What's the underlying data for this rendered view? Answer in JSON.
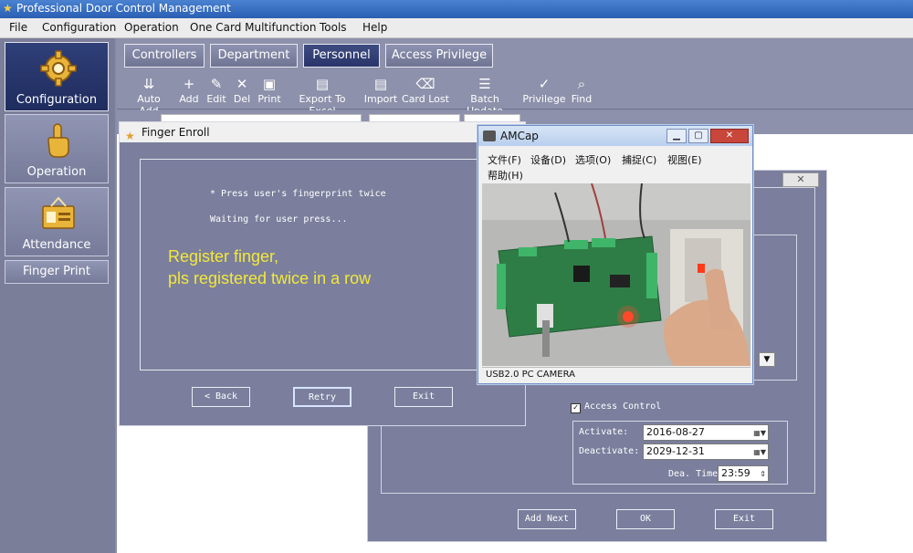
{
  "app": {
    "title": "Professional Door Control Management"
  },
  "menu": [
    "File",
    "Configuration",
    "Operation",
    "One Card Multifunction",
    "Tools",
    "Help"
  ],
  "sidebar": {
    "items": [
      {
        "label": "Configuration",
        "icon": "gear-icon",
        "active": true
      },
      {
        "label": "Operation",
        "icon": "hand-pointer-icon",
        "active": false
      },
      {
        "label": "Attendance",
        "icon": "attendance-card-icon",
        "active": false
      },
      {
        "label": "Finger Print",
        "icon": "",
        "active": false
      }
    ]
  },
  "tabs": [
    "Controllers",
    "Department",
    "Personnel",
    "Access Privilege"
  ],
  "toolbar": [
    {
      "label": "Auto Add",
      "icon": "auto-add-icon"
    },
    {
      "label": "Add",
      "icon": "plus-icon"
    },
    {
      "label": "Edit",
      "icon": "pencil-icon"
    },
    {
      "label": "Del",
      "icon": "x-icon"
    },
    {
      "label": "Print",
      "icon": "printer-icon"
    },
    {
      "label": "Export To Excel",
      "icon": "excel-icon"
    },
    {
      "label": "Import",
      "icon": "import-icon"
    },
    {
      "label": "Card Lost",
      "icon": "card-lost-icon"
    },
    {
      "label": "Batch Update",
      "icon": "batch-update-icon"
    },
    {
      "label": "Privilege",
      "icon": "privilege-icon"
    },
    {
      "label": "Find",
      "icon": "search-icon"
    }
  ],
  "finger_enroll": {
    "title": "Finger Enroll",
    "line1": "* Press user's fingerprint twice",
    "line2": "Waiting for user press...",
    "note_line1": "Register finger,",
    "note_line2": "pls registered twice in a row",
    "buttons": {
      "back": "< Back",
      "retry": "Retry",
      "exit": "Exit"
    }
  },
  "amcap": {
    "title": "AMCap",
    "menu_row1": [
      "文件(F)",
      "设备(D)",
      "选项(O)",
      "捕捉(C)",
      "视图(E)"
    ],
    "menu_row2": [
      "帮助(H)"
    ],
    "status": "USB2.0 PC CAMERA"
  },
  "privilege_dialog": {
    "access_control": {
      "label": "Access Control",
      "checked": true
    },
    "activate": {
      "label": "Activate:",
      "value": "2016-08-27"
    },
    "deactivate": {
      "label": "Deactivate:",
      "value": "2029-12-31"
    },
    "dea_time": {
      "label": "Dea. Time",
      "value": "23:59"
    },
    "buttons": {
      "add_next": "Add Next",
      "ok": "OK",
      "exit": "Exit"
    }
  }
}
